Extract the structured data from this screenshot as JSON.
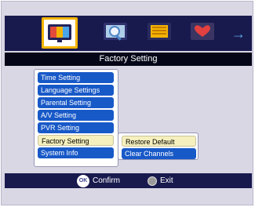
{
  "header": {
    "icons": [
      {
        "name": "tv-channels-icon",
        "selected": true
      },
      {
        "name": "search-icon",
        "selected": false
      },
      {
        "name": "book-icon",
        "selected": false
      },
      {
        "name": "heart-icon",
        "selected": false
      }
    ],
    "next_arrow": "→",
    "title": "Factory Setting"
  },
  "menu": {
    "items": [
      {
        "label": "Time Setting"
      },
      {
        "label": "Language Settings"
      },
      {
        "label": "Parental Setting"
      },
      {
        "label": "A/V Setting"
      },
      {
        "label": "PVR Setting"
      },
      {
        "label": "Factory Setting"
      },
      {
        "label": "System Info"
      }
    ]
  },
  "submenu": {
    "items": [
      {
        "label": "Restore Default"
      },
      {
        "label": "Clear Channels"
      }
    ]
  },
  "footer": {
    "ok_key": "OK",
    "confirm_label": "Confirm",
    "exit_label": "Exit"
  },
  "colors": {
    "accent_blue": "#1859c8",
    "selected_yellow": "#f5f0bd",
    "dark_bar": "#181a4e"
  }
}
